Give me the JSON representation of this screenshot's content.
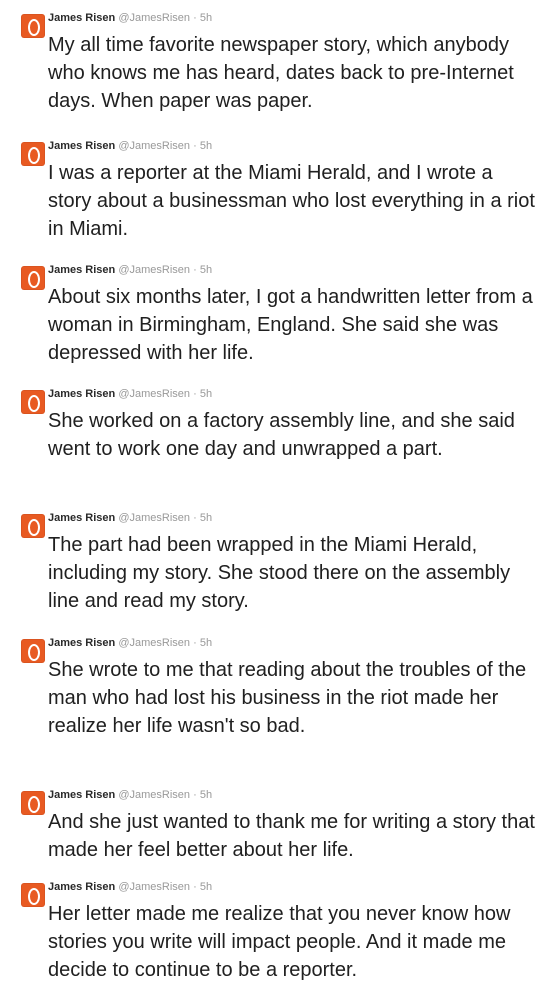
{
  "tweets": [
    {
      "name": "James Risen",
      "handle": "@JamesRisen",
      "sep": "·",
      "time": "5h",
      "text": "My all time favorite newspaper story, which anybody who knows me has heard, dates back to pre-Internet days. When paper was paper."
    },
    {
      "name": "James Risen",
      "handle": "@JamesRisen",
      "sep": "·",
      "time": "5h",
      "text": "I was a reporter at the Miami Herald, and I wrote a story about a businessman who lost everything in a riot in Miami."
    },
    {
      "name": "James Risen",
      "handle": "@JamesRisen",
      "sep": "·",
      "time": "5h",
      "text": "About six months later, I got a handwritten letter from a woman in Birmingham, England. She said she was depressed with her life."
    },
    {
      "name": "James Risen",
      "handle": "@JamesRisen",
      "sep": "·",
      "time": "5h",
      "text": "She worked on a factory assembly line, and she said went to work one day and unwrapped a part."
    },
    {
      "name": "James Risen",
      "handle": "@JamesRisen",
      "sep": "·",
      "time": "5h",
      "text": "The part had been wrapped in the Miami Herald, including my story. She stood there on the assembly line and read my story."
    },
    {
      "name": "James Risen",
      "handle": "@JamesRisen",
      "sep": "·",
      "time": "5h",
      "text": "She wrote to me that reading about the troubles of the man who had lost his business in the riot made her realize her life wasn't so bad."
    },
    {
      "name": "James Risen",
      "handle": "@JamesRisen",
      "sep": "·",
      "time": "5h",
      "text": "And she just wanted to thank me for writing a story that made her feel better about her life."
    },
    {
      "name": "James Risen",
      "handle": "@JamesRisen",
      "sep": "·",
      "time": "5h",
      "text": "Her letter made me realize that you never know how stories you write will impact people. And it made me decide to continue to be a reporter."
    }
  ],
  "colors": {
    "avatar": "#e85a22",
    "meta": "#999999",
    "text": "#202020"
  },
  "icons": {
    "avatar": "avatar-logo-icon"
  }
}
